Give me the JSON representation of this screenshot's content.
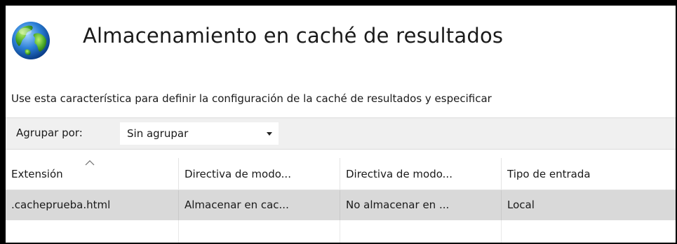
{
  "header": {
    "title": "Almacenamiento en caché de resultados",
    "icon": "globe-icon"
  },
  "description": "Use esta característica para definir la configuración de la caché de resultados y especificar",
  "toolbar": {
    "group_by_label": "Agrupar por:",
    "group_by_value": "Sin agrupar"
  },
  "table": {
    "columns": [
      {
        "label": "Extensión",
        "sorted": "ascending"
      },
      {
        "label": "Directiva de modo..."
      },
      {
        "label": "Directiva de modo..."
      },
      {
        "label": "Tipo de entrada"
      }
    ],
    "rows": [
      {
        "cells": [
          ".cacheprueba.html",
          "Almacenar en cac...",
          "No almacenar en ...",
          "Local"
        ],
        "selected": true
      }
    ]
  },
  "colors": {
    "selected_row": "#d9d9d9",
    "toolbar_bg": "#f0f0f0",
    "frame": "#000000"
  }
}
